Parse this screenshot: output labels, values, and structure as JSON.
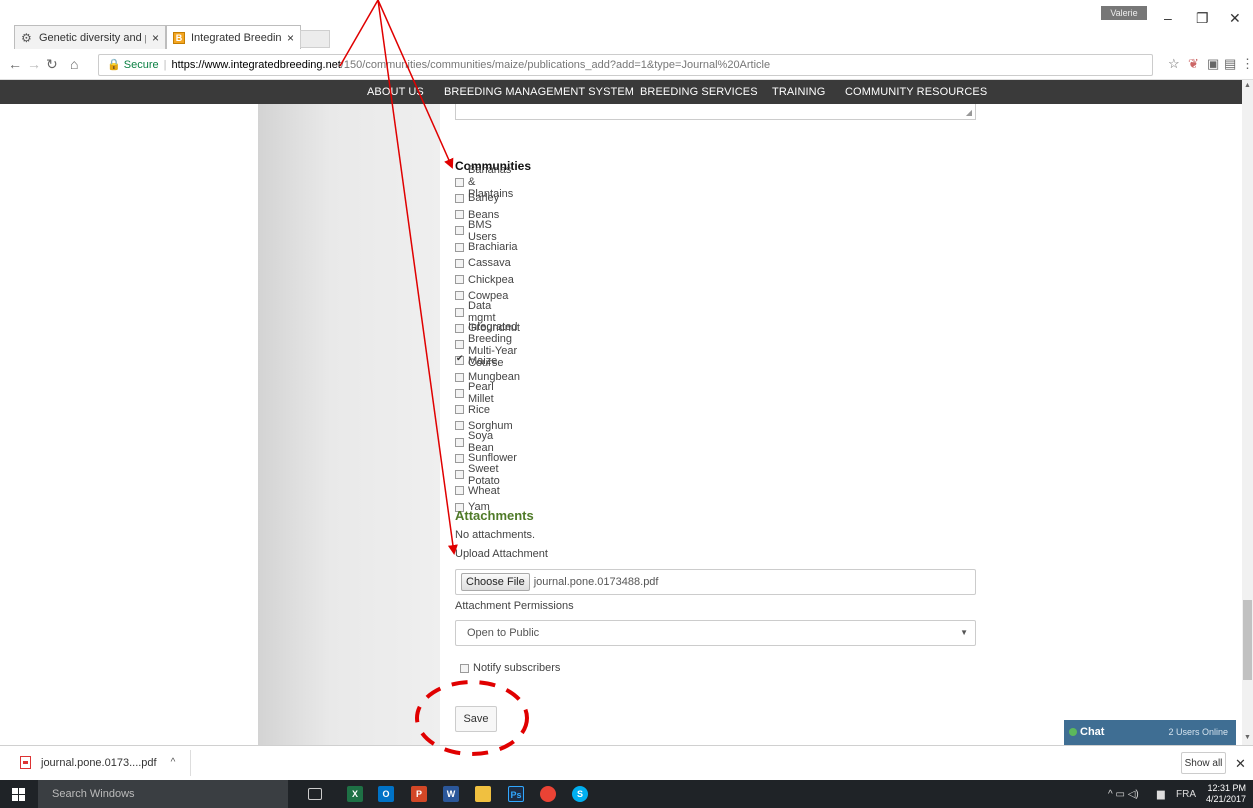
{
  "browser": {
    "tabs": [
      {
        "title": "Genetic diversity and po",
        "icon": "gear-icon"
      },
      {
        "title": "Integrated Breeding Plat",
        "icon": "ibp-logo-icon"
      }
    ],
    "profile_name": "Valerie",
    "address": {
      "secure_label": "Secure",
      "host": "https://www.integratedbreeding.net",
      "path": "/150/communities/communities/maize/publications_add?add=1&type=Journal%20Article"
    }
  },
  "site_nav": [
    "ABOUT US",
    "BREEDING MANAGEMENT SYSTEM",
    "BREEDING SERVICES",
    "TRAINING",
    "COMMUNITY RESOURCES"
  ],
  "communities": {
    "title": "Communities",
    "items": [
      {
        "label": "Bananas & Plantains",
        "checked": false
      },
      {
        "label": "Barley",
        "checked": false
      },
      {
        "label": "Beans",
        "checked": false
      },
      {
        "label": "BMS Users",
        "checked": false
      },
      {
        "label": "Brachiaria",
        "checked": false
      },
      {
        "label": "Cassava",
        "checked": false
      },
      {
        "label": "Chickpea",
        "checked": false
      },
      {
        "label": "Cowpea",
        "checked": false
      },
      {
        "label": "Data mgmt",
        "checked": false
      },
      {
        "label": "Groundnut",
        "checked": false
      },
      {
        "label": "Integrated Breeding Multi-Year Course",
        "checked": false
      },
      {
        "label": "Maize",
        "checked": true
      },
      {
        "label": "Mungbean",
        "checked": false
      },
      {
        "label": "Pearl Millet",
        "checked": false
      },
      {
        "label": "Rice",
        "checked": false
      },
      {
        "label": "Sorghum",
        "checked": false
      },
      {
        "label": "Soya Bean",
        "checked": false
      },
      {
        "label": "Sunflower",
        "checked": false
      },
      {
        "label": "Sweet Potato",
        "checked": false
      },
      {
        "label": "Wheat",
        "checked": false
      },
      {
        "label": "Yam",
        "checked": false
      }
    ]
  },
  "attachments": {
    "title": "Attachments",
    "none_text": "No attachments.",
    "upload_label": "Upload Attachment",
    "choose_file_label": "Choose File",
    "file_name": "journal.pone.0173488.pdf",
    "permissions_label": "Attachment Permissions",
    "permissions_value": "Open to Public",
    "notify_label": "Notify subscribers",
    "notify_checked": false
  },
  "save_label": "Save",
  "chat": {
    "label": "Chat",
    "users": "2 Users Online"
  },
  "download": {
    "file": "journal.pone.0173....pdf",
    "show_all": "Show all"
  },
  "taskbar": {
    "search_placeholder": "Search Windows",
    "language": "FRA",
    "time": "12:31 PM",
    "date": "4/21/2017"
  },
  "annotation_color": "#e00000"
}
